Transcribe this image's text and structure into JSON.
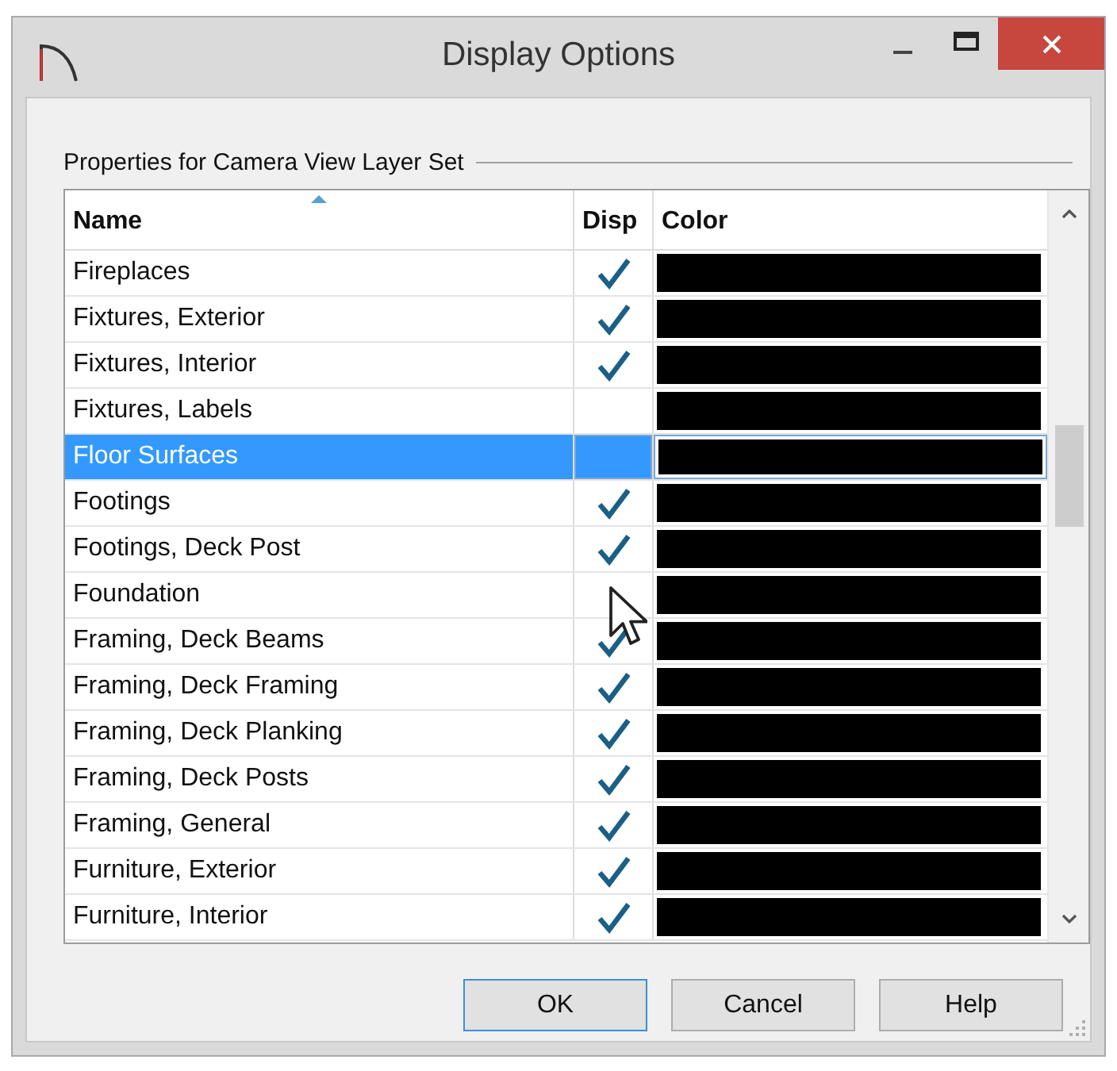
{
  "window": {
    "title": "Display Options"
  },
  "group": {
    "label": "Properties for Camera View Layer Set"
  },
  "table": {
    "columns": [
      {
        "label": "Name",
        "sorted": true
      },
      {
        "label": "Disp",
        "sorted": false
      },
      {
        "label": "Color",
        "sorted": false
      }
    ],
    "rows": [
      {
        "name": "Fireplaces",
        "disp": true,
        "color": "#000000",
        "selected": false
      },
      {
        "name": "Fixtures, Exterior",
        "disp": true,
        "color": "#000000",
        "selected": false
      },
      {
        "name": "Fixtures, Interior",
        "disp": true,
        "color": "#000000",
        "selected": false
      },
      {
        "name": "Fixtures, Labels",
        "disp": false,
        "color": "#000000",
        "selected": false
      },
      {
        "name": "Floor Surfaces",
        "disp": false,
        "color": "#000000",
        "selected": true
      },
      {
        "name": "Footings",
        "disp": true,
        "color": "#000000",
        "selected": false
      },
      {
        "name": "Footings, Deck Post",
        "disp": true,
        "color": "#000000",
        "selected": false
      },
      {
        "name": "Foundation",
        "disp": false,
        "color": "#000000",
        "selected": false
      },
      {
        "name": "Framing, Deck Beams",
        "disp": true,
        "color": "#000000",
        "selected": false
      },
      {
        "name": "Framing, Deck Framing",
        "disp": true,
        "color": "#000000",
        "selected": false
      },
      {
        "name": "Framing, Deck Planking",
        "disp": true,
        "color": "#000000",
        "selected": false
      },
      {
        "name": "Framing, Deck Posts",
        "disp": true,
        "color": "#000000",
        "selected": false
      },
      {
        "name": "Framing, General",
        "disp": true,
        "color": "#000000",
        "selected": false
      },
      {
        "name": "Furniture, Exterior",
        "disp": true,
        "color": "#000000",
        "selected": false
      },
      {
        "name": "Furniture, Interior",
        "disp": true,
        "color": "#000000",
        "selected": false
      }
    ]
  },
  "buttons": [
    {
      "label": "OK",
      "default": true
    },
    {
      "label": "Cancel",
      "default": false
    },
    {
      "label": "Help",
      "default": false
    }
  ]
}
